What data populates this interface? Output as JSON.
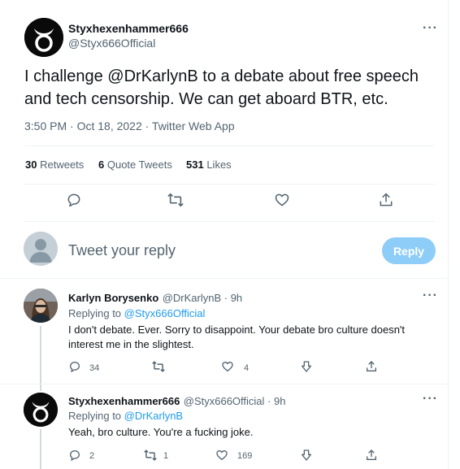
{
  "main_tweet": {
    "display_name": "Styxhexenhammer666",
    "handle": "@Styx666Official",
    "more_label": "···",
    "text": "I challenge @DrKarlynB to a debate about free speech and tech censorship. We can get aboard BTR, etc.",
    "timestamp": "3:50 PM · Oct 18, 2022 · Twitter Web App",
    "stats": {
      "retweets_count": "30",
      "retweets_label": "Retweets",
      "quotes_count": "6",
      "quotes_label": "Quote Tweets",
      "likes_count": "531",
      "likes_label": "Likes"
    }
  },
  "composer": {
    "placeholder": "Tweet your reply",
    "reply_button": "Reply"
  },
  "replies": [
    {
      "display_name": "Karlyn Borysenko",
      "handle_time": "@DrKarlynB · 9h",
      "replying_prefix": "Replying to",
      "replying_to": "@Styx666Official",
      "text": "I don't debate. Ever. Sorry to disappoint. Your debate bro culture doesn't interest me in the slightest.",
      "counts": {
        "reply": "34",
        "retweet": "",
        "like": "4"
      },
      "more_label": "···"
    },
    {
      "display_name": "Styxhexenhammer666",
      "handle_time": "@Styx666Official · 9h",
      "replying_prefix": "Replying to",
      "replying_to": "@DrKarlynB",
      "text": "Yeah, bro culture. You're a fucking joke.",
      "counts": {
        "reply": "2",
        "retweet": "1",
        "like": "169"
      },
      "more_label": "···"
    }
  ],
  "colors": {
    "accent": "#1d9bf0",
    "reply_button_disabled": "#8ecdf8",
    "secondary_text": "#536471",
    "divider": "#eff3f4"
  },
  "icons": {
    "reply": "speech-bubble-icon",
    "retweet": "retweet-arrows-icon",
    "like": "heart-icon",
    "share": "share-upload-icon",
    "more": "ellipsis-icon"
  }
}
